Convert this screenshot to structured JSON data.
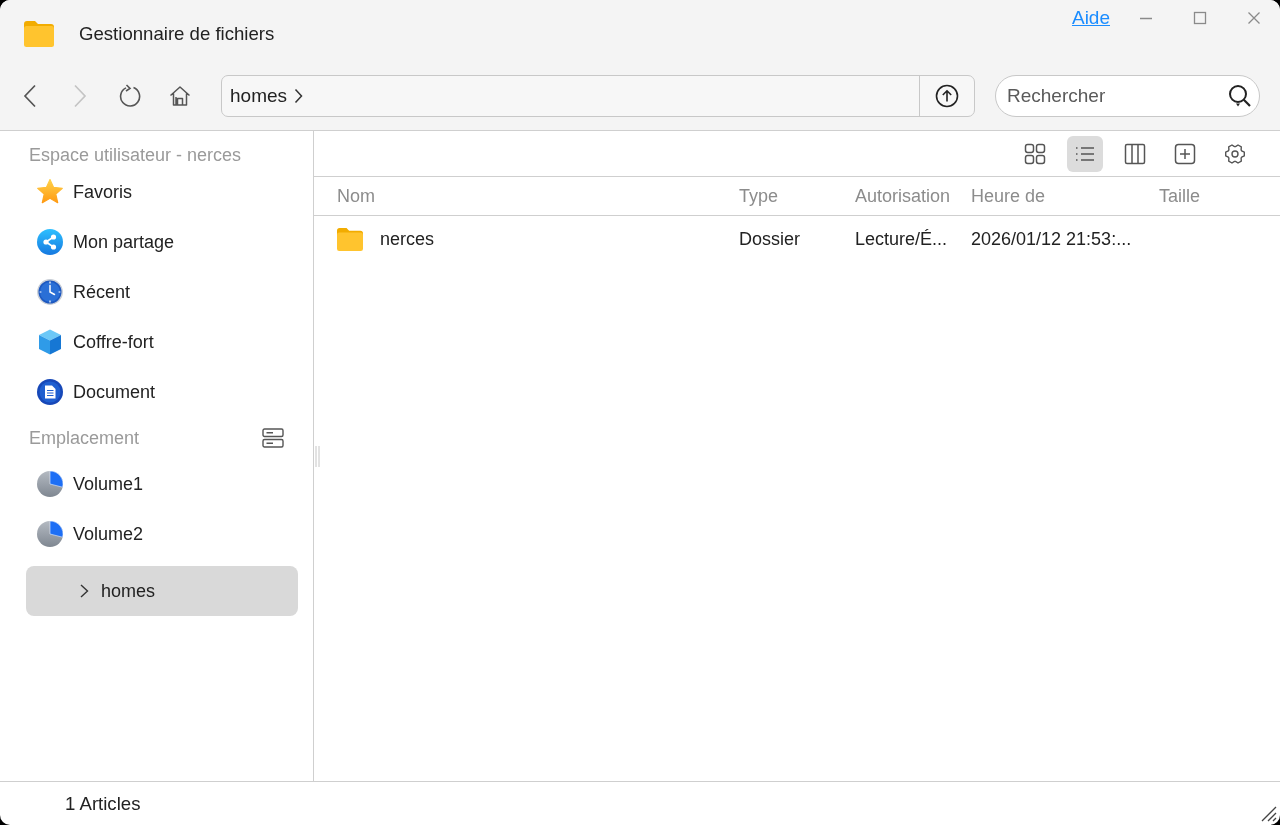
{
  "window": {
    "title": "Gestionnaire de fichiers",
    "help_link": "Aide"
  },
  "navigation": [
    {
      "kind": "back",
      "disabled": false
    },
    {
      "kind": "forward",
      "disabled": true
    },
    {
      "kind": "refresh",
      "disabled": false
    },
    {
      "kind": "home",
      "disabled": false
    }
  ],
  "path": {
    "segments": [
      "homes"
    ]
  },
  "search": {
    "placeholder": "Rechercher"
  },
  "sidebar": {
    "sections": [
      {
        "kind": "user_space",
        "heading": "Espace utilisateur - nerces",
        "items": [
          {
            "label": "Favoris",
            "kind": "favorites",
            "selected": false
          },
          {
            "label": "Mon partage",
            "kind": "share",
            "selected": false
          },
          {
            "label": "Récent",
            "kind": "recent",
            "selected": false
          },
          {
            "label": "Coffre-fort",
            "kind": "vault",
            "selected": false
          },
          {
            "label": "Document",
            "kind": "document",
            "selected": false
          }
        ]
      },
      {
        "kind": "locations",
        "heading": "Emplacement",
        "items": [
          {
            "label": "Volume1",
            "kind": "volume",
            "selected": false
          },
          {
            "label": "Volume2",
            "kind": "volume",
            "selected": false
          },
          {
            "label": "homes",
            "kind": "folder",
            "selected": true,
            "expanded": false
          }
        ]
      }
    ]
  },
  "view_modes": [
    {
      "kind": "grid",
      "selected": false
    },
    {
      "kind": "list",
      "selected": true
    },
    {
      "kind": "columns",
      "selected": false
    }
  ],
  "table": {
    "columns": [
      "Nom",
      "Type",
      "Autorisation",
      "Heure de",
      "Taille"
    ],
    "rows": [
      {
        "name": "nerces",
        "kind": "folder",
        "type": "Dossier",
        "permission": "Lecture/É...",
        "modified": "2026/01/12 21:53:...",
        "selected": false
      }
    ]
  },
  "status_bar": {
    "item_count": "1 Articles"
  }
}
